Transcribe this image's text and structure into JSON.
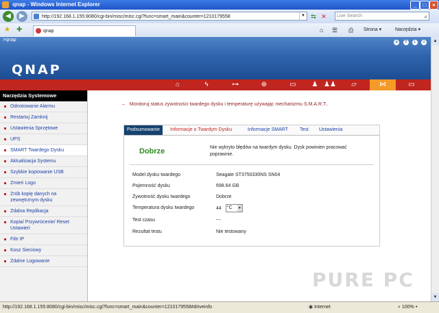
{
  "window": {
    "title": "qnap - Windows Internet Explorer"
  },
  "browser": {
    "url": "http://192.168.1.155:8080/cgi-bin/misc/misc.cgi?func=smart_main&counter=1210179558",
    "search_placeholder": "Live Search",
    "tab_title": "qnap",
    "tools": {
      "strona": "Strona",
      "narzedzia": "Narzędzia"
    }
  },
  "header": {
    "small_label": ">qnap",
    "logo": "QNAP",
    "top_icons": [
      "x",
      "?",
      "i",
      "≡"
    ]
  },
  "icons": [
    "home-icon",
    "lightning-icon",
    "network-icon",
    "settings-icon",
    "drive-icon",
    "user-icon",
    "users-icon",
    "folder-icon",
    "tools-icon",
    "docs-icon"
  ],
  "sidebar": {
    "heading": "Narzędzia Systemowe",
    "items": [
      "Odnotowanie Alarmu",
      "Restartuj Zamknij",
      "Ustawienia Sprzętowe",
      "UPS",
      "SMART Twardego Dysku",
      "Aktualizacja Systemu",
      "Szybkie kopiowanie USB",
      "Zmień Logo",
      "Zrób kopię danych na zewnętrznym dysku",
      "Zdalna Replikacja",
      "Kopia/ Przywrócenie/ Reset Ustawień",
      "Filtr IP",
      "Kosz Sieciowy",
      "Zdalne Logowanie"
    ],
    "active_index": 4
  },
  "main": {
    "monitor_text": "Monitoruj status żywotności twardego dysku i temperaturę używając mechanizmu S.M.A.R.T..",
    "tabs": [
      "Podsumowanie",
      "Informacje o Twardym Dysku",
      "Informacje SMART",
      "Test",
      "Ustawienia"
    ],
    "status_word": "Dobrze",
    "status_message": "Nie wykryto błędów na twardym dysku. Dysk powinien pracować poprawnie.",
    "rows": [
      {
        "label": "Model dysku twardego",
        "value": "Seagate ST3750330NS SN04"
      },
      {
        "label": "Pojemność dysku",
        "value": "698.64 GB"
      },
      {
        "label": "Żywotność dysku twardego",
        "value": "Dobrze"
      },
      {
        "label": "Temperatura dysku twardego",
        "value": "44"
      },
      {
        "label": "Test czasu",
        "value": "---"
      },
      {
        "label": "Rezultat testu",
        "value": "Nie testowany"
      }
    ],
    "temp_unit": "°C"
  },
  "statusbar": {
    "url": "http://192.168.1.155:8080/cgi-bin/misc/misc.cgi?func=smart_main&counter=1210179558#driveinfo",
    "zone": "Internet",
    "zoom": "100%"
  },
  "watermark": "PURE PC"
}
